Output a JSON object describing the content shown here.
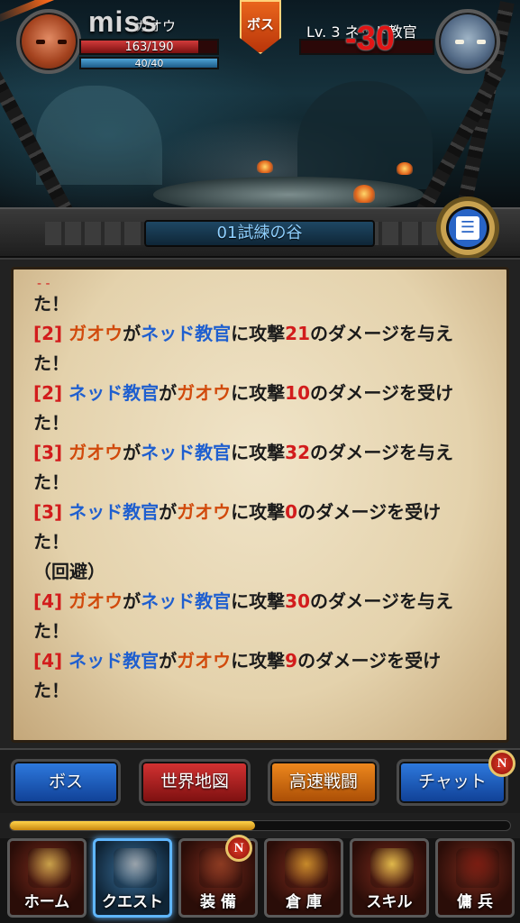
{
  "battle": {
    "miss_text": "miss",
    "player": {
      "name": "ガオウ",
      "hp_text": "163/190",
      "hp_fraction": 0.858,
      "mp_text": "40/40",
      "mp_fraction": 1.0
    },
    "boss_badge": "ボス",
    "enemy": {
      "name_text": "Lv. 3 ネッド教官",
      "hp_fraction": 0.0
    },
    "damage_popup": "-30"
  },
  "stage": {
    "title": "01試練の谷",
    "log_icon": "scroll-log-icon"
  },
  "log": {
    "lines": [
      {
        "parts": [
          {
            "t": "た！",
            "c": "plain"
          }
        ]
      },
      {
        "parts": [
          {
            "t": "[2] ",
            "c": "tag"
          },
          {
            "t": "ガオウ",
            "c": "ally"
          },
          {
            "t": "が",
            "c": "plain"
          },
          {
            "t": "ネッド教官",
            "c": "foe"
          },
          {
            "t": "に攻撃",
            "c": "plain"
          },
          {
            "t": "21",
            "c": "num"
          },
          {
            "t": "のダメージを与え",
            "c": "plain"
          }
        ]
      },
      {
        "parts": [
          {
            "t": "た！",
            "c": "plain"
          }
        ]
      },
      {
        "parts": [
          {
            "t": "[2] ",
            "c": "tag"
          },
          {
            "t": "ネッド教官",
            "c": "foe"
          },
          {
            "t": "が",
            "c": "plain"
          },
          {
            "t": "ガオウ",
            "c": "ally"
          },
          {
            "t": "に攻撃",
            "c": "plain"
          },
          {
            "t": "10",
            "c": "num"
          },
          {
            "t": "のダメージを受け",
            "c": "plain"
          }
        ]
      },
      {
        "parts": [
          {
            "t": "た！",
            "c": "plain"
          }
        ]
      },
      {
        "parts": [
          {
            "t": "[3] ",
            "c": "tag"
          },
          {
            "t": "ガオウ",
            "c": "ally"
          },
          {
            "t": "が",
            "c": "plain"
          },
          {
            "t": "ネッド教官",
            "c": "foe"
          },
          {
            "t": "に攻撃",
            "c": "plain"
          },
          {
            "t": "32",
            "c": "num"
          },
          {
            "t": "のダメージを与え",
            "c": "plain"
          }
        ]
      },
      {
        "parts": [
          {
            "t": "た！",
            "c": "plain"
          }
        ]
      },
      {
        "parts": [
          {
            "t": "[3] ",
            "c": "tag"
          },
          {
            "t": "ネッド教官",
            "c": "foe"
          },
          {
            "t": "が",
            "c": "plain"
          },
          {
            "t": "ガオウ",
            "c": "ally"
          },
          {
            "t": "に攻撃",
            "c": "plain"
          },
          {
            "t": "0",
            "c": "num"
          },
          {
            "t": "のダメージを受け",
            "c": "plain"
          }
        ]
      },
      {
        "parts": [
          {
            "t": "た！",
            "c": "plain"
          }
        ]
      },
      {
        "parts": [
          {
            "t": "（回避）",
            "c": "plain"
          }
        ]
      },
      {
        "parts": [
          {
            "t": "[4] ",
            "c": "tag"
          },
          {
            "t": "ガオウ",
            "c": "ally"
          },
          {
            "t": "が",
            "c": "plain"
          },
          {
            "t": "ネッド教官",
            "c": "foe"
          },
          {
            "t": "に攻撃",
            "c": "plain"
          },
          {
            "t": "30",
            "c": "num"
          },
          {
            "t": "のダメージを与え",
            "c": "plain"
          }
        ]
      },
      {
        "parts": [
          {
            "t": "た！",
            "c": "plain"
          }
        ]
      },
      {
        "parts": [
          {
            "t": "[4] ",
            "c": "tag"
          },
          {
            "t": "ネッド教官",
            "c": "foe"
          },
          {
            "t": "が",
            "c": "plain"
          },
          {
            "t": "ガオウ",
            "c": "ally"
          },
          {
            "t": "に攻撃",
            "c": "plain"
          },
          {
            "t": "9",
            "c": "num"
          },
          {
            "t": "のダメージを受け",
            "c": "plain"
          }
        ]
      },
      {
        "parts": [
          {
            "t": "た！",
            "c": "plain"
          }
        ]
      }
    ]
  },
  "actions": {
    "boss": "ボス",
    "world_map": "世界地図",
    "fast_battle": "高速戦闘",
    "chat": "チャット",
    "chat_badge": "N"
  },
  "exp": {
    "fraction": 0.49
  },
  "nav": {
    "items": [
      {
        "label": "ホーム",
        "icon": "home-shield-icon",
        "active": false,
        "badge": ""
      },
      {
        "label": "クエスト",
        "icon": "crossed-swords-icon",
        "active": true,
        "badge": ""
      },
      {
        "label": "装 備",
        "icon": "armor-icon",
        "active": false,
        "badge": "N"
      },
      {
        "label": "倉 庫",
        "icon": "treasure-chest-icon",
        "active": false,
        "badge": ""
      },
      {
        "label": "スキル",
        "icon": "spellbook-icon",
        "active": false,
        "badge": ""
      },
      {
        "label": "傭 兵",
        "icon": "hooded-mercenary-icon",
        "active": false,
        "badge": ""
      }
    ]
  },
  "colors": {
    "ally": "#d14a0c",
    "foe": "#1f5fcf",
    "tag": "#d21c1c",
    "accent_blue": "#2f7be0",
    "accent_red": "#d63333",
    "accent_orange": "#f08a1e"
  }
}
